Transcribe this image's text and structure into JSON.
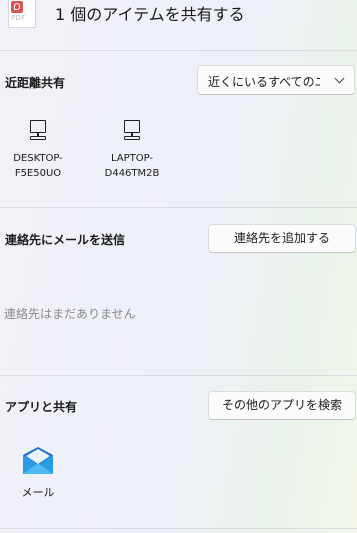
{
  "header": {
    "file_icon_ext": "PDF",
    "title": "1 個のアイテムを共有する"
  },
  "nearby": {
    "label": "近距離共有",
    "dropdown_value": "近くにいるすべてのユ",
    "devices": [
      {
        "name_line1": "DESKTOP-",
        "name_line2": "F5E50UO"
      },
      {
        "name_line1": "LAPTOP-",
        "name_line2": "D446TM2B"
      }
    ]
  },
  "contacts": {
    "label": "連絡先にメールを送信",
    "add_button": "連絡先を追加する",
    "empty_text": "連絡先はまだありません"
  },
  "apps": {
    "label": "アプリと共有",
    "search_button": "その他のアプリを検索",
    "items": [
      {
        "label": "メール"
      }
    ]
  }
}
